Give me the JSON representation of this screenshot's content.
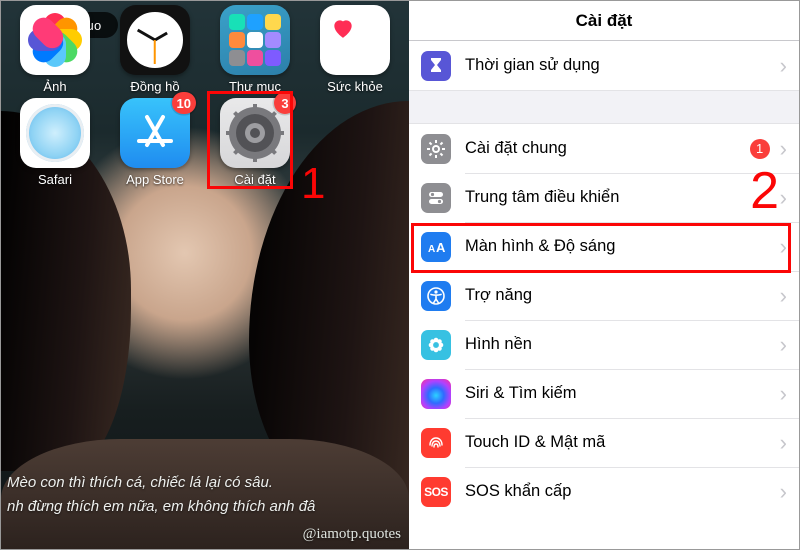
{
  "home": {
    "pill_label": "quo",
    "apps": [
      {
        "id": "photos",
        "label": "Ảnh"
      },
      {
        "id": "clock",
        "label": "Đồng hồ"
      },
      {
        "id": "folder",
        "label": "Thư mục"
      },
      {
        "id": "health",
        "label": "Sức khỏe"
      },
      {
        "id": "safari",
        "label": "Safari"
      },
      {
        "id": "appstore",
        "label": "App Store",
        "badge": "10"
      },
      {
        "id": "settings",
        "label": "Cài đặt",
        "badge": "3"
      }
    ],
    "quote_line1": "Mèo con thì thích cá, chiếc lá lại có sâu.",
    "quote_line2": "nh đừng thích em nữa, em không thích anh đâ",
    "handle": "@iamotp.quotes",
    "annotation_number": "1"
  },
  "settings": {
    "title": "Cài đặt",
    "group1": [
      {
        "id": "screentime",
        "label": "Thời gian sử dụng",
        "icon_bg": "#5856d6"
      }
    ],
    "group2": [
      {
        "id": "general",
        "label": "Cài đặt chung",
        "icon_bg": "#8e8e92",
        "note": "1"
      },
      {
        "id": "control",
        "label": "Trung tâm điều khiển",
        "icon_bg": "#8e8e92"
      },
      {
        "id": "display",
        "label": "Màn hình & Độ sáng",
        "icon_bg": "#1f7cf0"
      },
      {
        "id": "access",
        "label": "Trợ năng",
        "icon_bg": "#1f7cf0"
      },
      {
        "id": "wallpaper",
        "label": "Hình nền",
        "icon_bg": "#37c1e2"
      },
      {
        "id": "siri",
        "label": "Siri & Tìm kiếm",
        "icon_bg": "#000000"
      },
      {
        "id": "touchid",
        "label": "Touch ID & Mật mã",
        "icon_bg": "#ff3b30"
      },
      {
        "id": "sos",
        "label": "SOS khẩn cấp",
        "icon_bg": "#ff3b30"
      }
    ],
    "annotation_number": "2"
  }
}
